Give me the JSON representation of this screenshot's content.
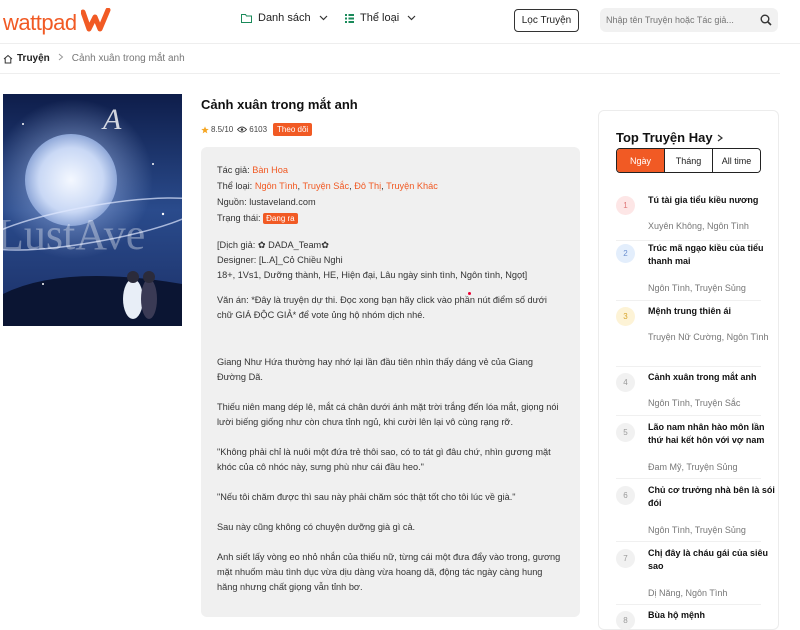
{
  "header": {
    "logo_text": "wattpad",
    "nav": [
      {
        "label": "Danh sách",
        "icon": "folder-icon"
      },
      {
        "label": "Thể loại",
        "icon": "grid-icon"
      }
    ],
    "filter_label": "Lọc Truyện",
    "search_placeholder": "Nhập tên Truyện hoặc Tác giả..."
  },
  "breadcrumb": {
    "home": "Truyện",
    "current": "Cảnh xuân trong mắt anh"
  },
  "story": {
    "title": "Cảnh xuân trong mắt anh",
    "rating": "8.5/10",
    "views": "6103",
    "follow_label": "Theo dõi",
    "author_label": "Tác giả:",
    "author": "Bàn Hoa",
    "genre_label": "Thể loại:",
    "genres": [
      "Ngôn Tình",
      "Truyện Sắc",
      "Đô Thị",
      "Truyện Khác"
    ],
    "source_label": "Nguồn:",
    "source": "lustaveland.com",
    "status_label": "Trạng thái:",
    "status": "Đang ra",
    "desc_line1": "[Dịch giả: ✿ DADA_Team✿",
    "desc_line2": "Designer: [L.A]_Cỏ Chiều Nghi",
    "desc_line3": "18+, 1Vs1, Dưỡng thành, HE, Hiện đại, Lâu ngày sinh tình, Ngôn tình, Ngọt]",
    "para1": "Văn án: *Đây là truyện dự thi. Đọc xong bạn hãy click vào phần nút điểm số dưới chữ GIÁ ĐỘC GIẢ* để vote ủng hộ nhóm dịch nhé.",
    "para2": "Giang Như Hứa thường hay nhớ lại lần đầu tiên nhìn thấy dáng vẻ của Giang Đường Dã.",
    "para3": "Thiếu niên mang dép lê, mắt cá chân dưới ánh mặt trời trắng đến lóa mắt, giọng nói lười biếng giống như còn chưa tỉnh ngủ, khi cười lên lại vô cùng rạng rỡ.",
    "para4": "\"Không phải chỉ là nuôi một đứa trẻ thôi sao, có to tát gì đâu chứ, nhìn gương mặt khóc của cô nhóc này, sưng phù như cái đầu heo.\"",
    "para5": "\"Nếu tôi chăm được thì sau này phải chăm sóc thật tốt cho tôi lúc về già.\"",
    "para6": "Sau này cũng không có chuyện dưỡng già gì cả.",
    "para7": "Anh siết lấy vòng eo nhỏ nhắn của thiếu nữ, từng cái một đưa đẩy vào trong, gương mặt nhuốm màu tình dục vừa dịu dàng vừa hoang dã, động tác ngày càng hung hăng nhưng chất giọng vẫn tỉnh bơ."
  },
  "sidebar": {
    "title": "Top Truyện Hay",
    "tabs": [
      "Ngày",
      "Tháng",
      "All time"
    ],
    "items": [
      {
        "num": "1",
        "title": "Tú tài gia tiểu kiều nương",
        "genre": "Xuyên Không, Ngôn Tình"
      },
      {
        "num": "2",
        "title": "Trúc mã ngạo kiều của tiểu thanh mai",
        "genre": "Ngôn Tình, Truyện Sủng"
      },
      {
        "num": "3",
        "title": "Mệnh trung thiên ái",
        "genre": "Truyện Nữ Cường, Ngôn Tình"
      },
      {
        "num": "4",
        "title": "Cảnh xuân trong mắt anh",
        "genre": "Ngôn Tình, Truyện Sắc"
      },
      {
        "num": "5",
        "title": "Lão nam nhân hào môn lần thứ hai kết hôn với vợ nam",
        "genre": "Đam Mỹ, Truyện Sủng"
      },
      {
        "num": "6",
        "title": "Chủ cơ trưởng nhà bên là sói đói",
        "genre": "Ngôn Tình, Truyện Sủng"
      },
      {
        "num": "7",
        "title": "Chị đây là cháu gái của siêu sao",
        "genre": "Dị Năng, Ngôn Tình"
      },
      {
        "num": "8",
        "title": "Bùa hộ mệnh",
        "genre": ""
      }
    ]
  },
  "colors": {
    "accent": "#f15a24"
  }
}
